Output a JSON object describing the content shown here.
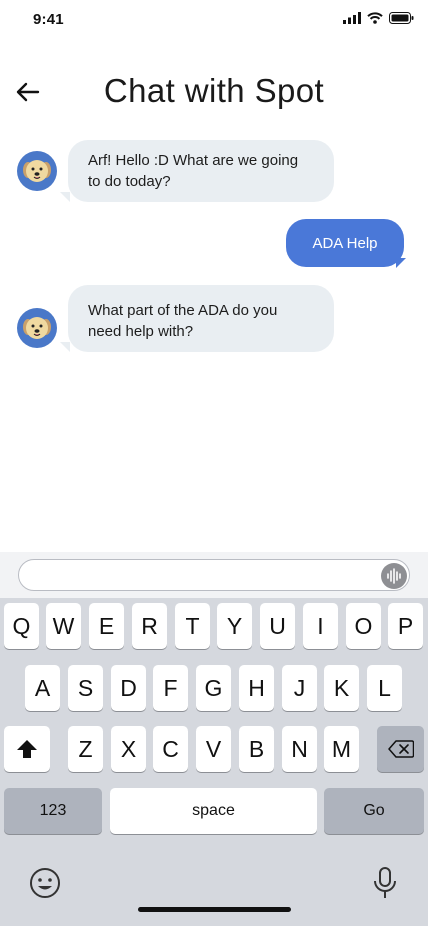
{
  "status": {
    "time": "9:41",
    "icons": [
      "signal-icon",
      "wifi-icon",
      "battery-icon"
    ]
  },
  "header": {
    "back_icon": "back-arrow-icon",
    "title": "Chat with Spot"
  },
  "messages": [
    {
      "sender": "Spot",
      "direction": "incoming",
      "text": "Arf! Hello :D What are we going to do today?",
      "avatar": "dog-avatar"
    },
    {
      "sender": "user",
      "direction": "outgoing",
      "text": "ADA Help"
    },
    {
      "sender": "Spot",
      "direction": "incoming",
      "text": "What part of the ADA do you need help with?",
      "avatar": "dog-avatar"
    }
  ],
  "composer": {
    "value": "",
    "placeholder": "",
    "voice_icon": "waveform-icon"
  },
  "keyboard": {
    "row1": [
      "Q",
      "W",
      "E",
      "R",
      "T",
      "Y",
      "U",
      "I",
      "O",
      "P"
    ],
    "row2": [
      "A",
      "S",
      "D",
      "F",
      "G",
      "H",
      "J",
      "K",
      "L"
    ],
    "row3": [
      "Z",
      "X",
      "C",
      "V",
      "B",
      "N",
      "M"
    ],
    "shift_icon": "shift-icon",
    "delete_icon": "delete-icon",
    "numbers_label": "123",
    "space_label": "space",
    "go_label": "Go",
    "emoji_icon": "emoji-icon",
    "mic_icon": "microphone-icon"
  },
  "colors": {
    "accent": "#4a78d8",
    "incoming_bubble": "#e9eef2",
    "avatar_bg": "#4a78c8",
    "keyboard_bg": "#d5d8de"
  }
}
